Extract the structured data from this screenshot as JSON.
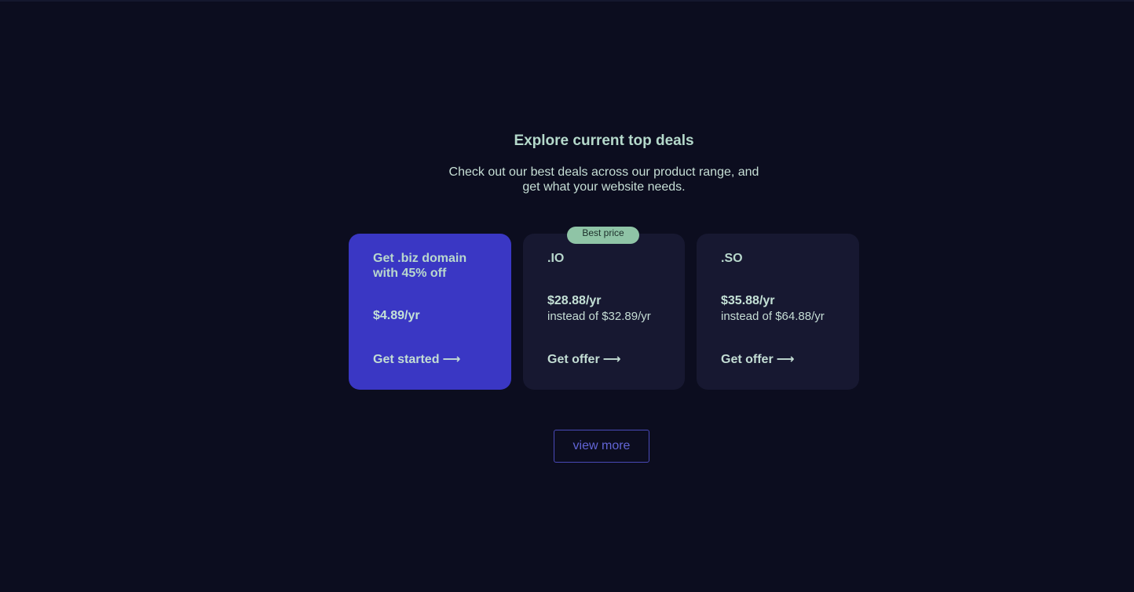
{
  "section": {
    "heading": "Explore current top deals",
    "subtitle": "Check out our best deals across our product range, and get what your website needs."
  },
  "deals": [
    {
      "title": "Get .biz domain with 45% off",
      "price": "$4.89/yr",
      "old_price": "",
      "cta": "Get started",
      "badge": ""
    },
    {
      "title": ".IO",
      "price": "$28.88/yr",
      "old_price": "instead of $32.89/yr",
      "cta": "Get offer",
      "badge": "Best price"
    },
    {
      "title": ".SO",
      "price": "$35.88/yr",
      "old_price": "instead of $64.88/yr",
      "cta": "Get offer",
      "badge": ""
    }
  ],
  "view_more_label": "view more",
  "icons": {
    "cta_arrow": "long-right-arrow-icon"
  },
  "colors": {
    "background": "#0c0d1f",
    "primary_card": "#3a37c4",
    "dark_card": "#171831",
    "badge": "#8fc4a6",
    "text": "#b5d9cb",
    "button_border": "#4a4ab8"
  }
}
